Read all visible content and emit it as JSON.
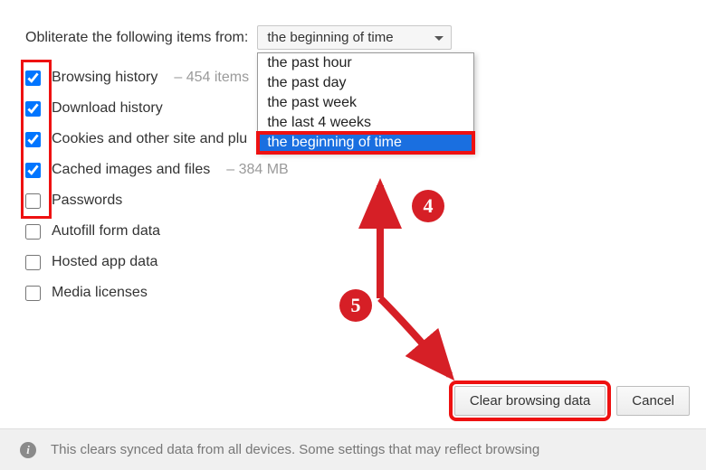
{
  "prompt": "Obliterate the following items from:",
  "dropdown": {
    "selected": "the beginning of time",
    "options": [
      "the past hour",
      "the past day",
      "the past week",
      "the last 4 weeks",
      "the beginning of time"
    ]
  },
  "items": [
    {
      "label": "Browsing history",
      "sub": "– 454 items",
      "checked": true
    },
    {
      "label": "Download history",
      "sub": "",
      "checked": true
    },
    {
      "label": "Cookies and other site and plu",
      "sub": "",
      "checked": true
    },
    {
      "label": "Cached images and files",
      "sub": "– 384 MB",
      "checked": true
    },
    {
      "label": "Passwords",
      "sub": "",
      "checked": false
    },
    {
      "label": "Autofill form data",
      "sub": "",
      "checked": false
    },
    {
      "label": "Hosted app data",
      "sub": "",
      "checked": false
    },
    {
      "label": "Media licenses",
      "sub": "",
      "checked": false
    }
  ],
  "buttons": {
    "clear": "Clear browsing data",
    "cancel": "Cancel"
  },
  "footer_text": "This clears synced data from all devices. Some settings that may reflect browsing",
  "annotations": {
    "badge4": "4",
    "badge5": "5"
  },
  "colors": {
    "highlight_red": "#e11",
    "selection_blue": "#1a6fe0"
  }
}
